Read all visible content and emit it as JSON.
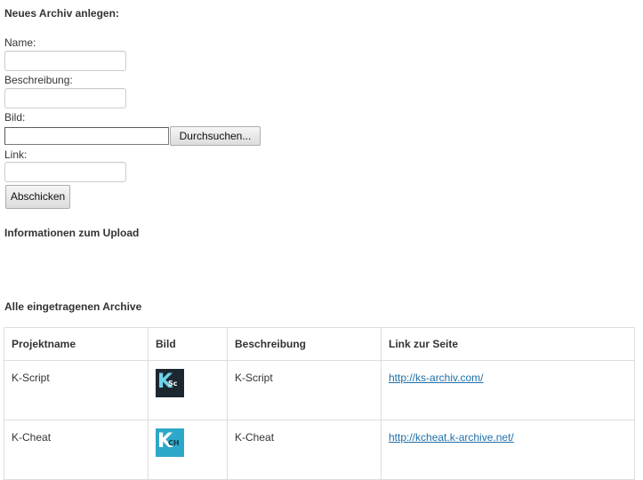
{
  "form": {
    "title": "Neues Archiv anlegen:",
    "name_label": "Name:",
    "name_value": "",
    "description_label": "Beschreibung:",
    "description_value": "",
    "image_label": "Bild:",
    "browse_label": "Durchsuchen...",
    "link_label": "Link:",
    "link_value": "",
    "submit_label": "Abschicken"
  },
  "upload_info": {
    "title": "Informationen zum Upload"
  },
  "archives": {
    "title": "Alle eingetragenen Archive",
    "headers": [
      "Projektname",
      "Bild",
      "Beschreibung",
      "Link zur Seite"
    ],
    "rows": [
      {
        "name": "K-Script",
        "image_icon": "k-script-logo-icon",
        "description": "K-Script",
        "link": "http://ks-archiv.com/"
      },
      {
        "name": "K-Cheat",
        "image_icon": "k-cheat-logo-icon",
        "description": "K-Cheat",
        "link": "http://kcheat.k-archive.net/"
      }
    ]
  },
  "colors": {
    "link": "#1f6fa8",
    "table_border": "#dddddd",
    "text": "#333333"
  }
}
